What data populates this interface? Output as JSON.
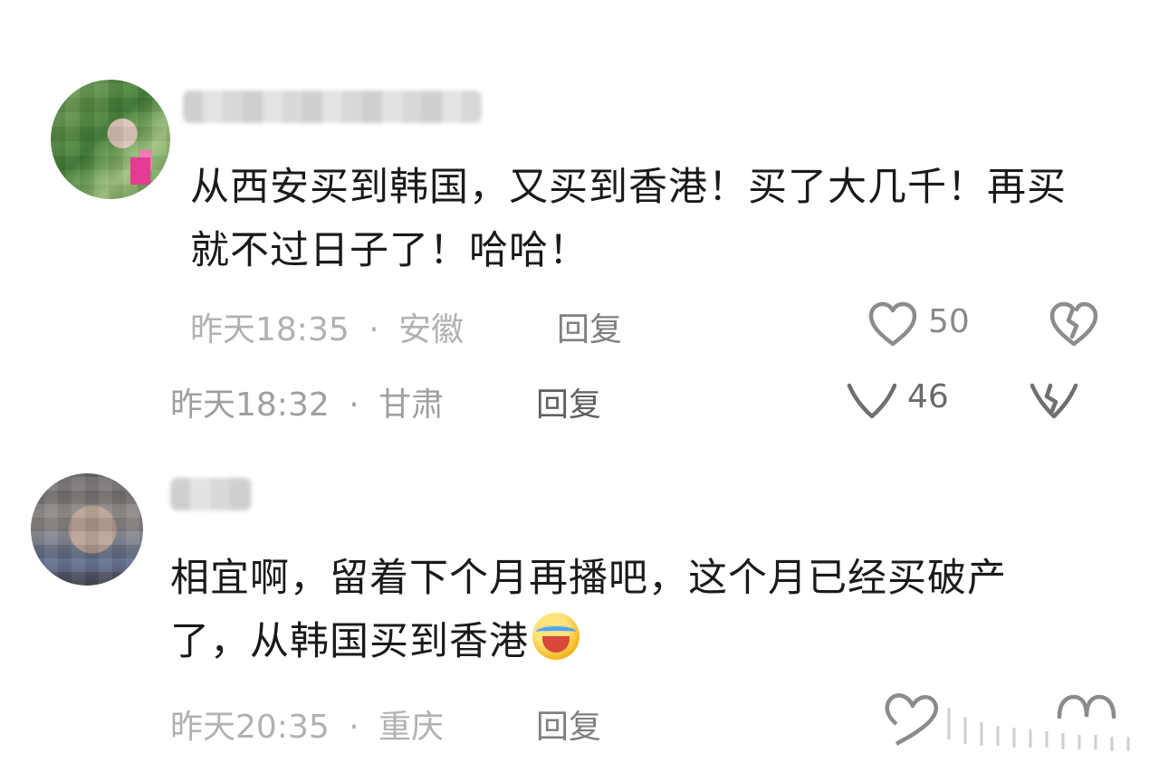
{
  "comments": [
    {
      "text": "从西安买到韩国，又买到香港！买了大几千！再买就不过日子了！哈哈！",
      "time": "昨天18:35",
      "separator": "·",
      "location": "安徽",
      "reply_label": "回复",
      "likes": "50"
    },
    {
      "time": "昨天18:32",
      "separator": "·",
      "location": "甘肃",
      "reply_label": "回复",
      "likes": "46"
    },
    {
      "text": "相宜啊，留着下个月再播吧，这个月已经买破产了，从韩国买到香港",
      "time": "昨天20:35",
      "separator": "·",
      "location": "重庆",
      "reply_label": "回复"
    }
  ],
  "icons": {
    "like": "heart-outline-icon",
    "dislike": "broken-heart-icon",
    "emoji": "laughing-crying-emoji"
  }
}
